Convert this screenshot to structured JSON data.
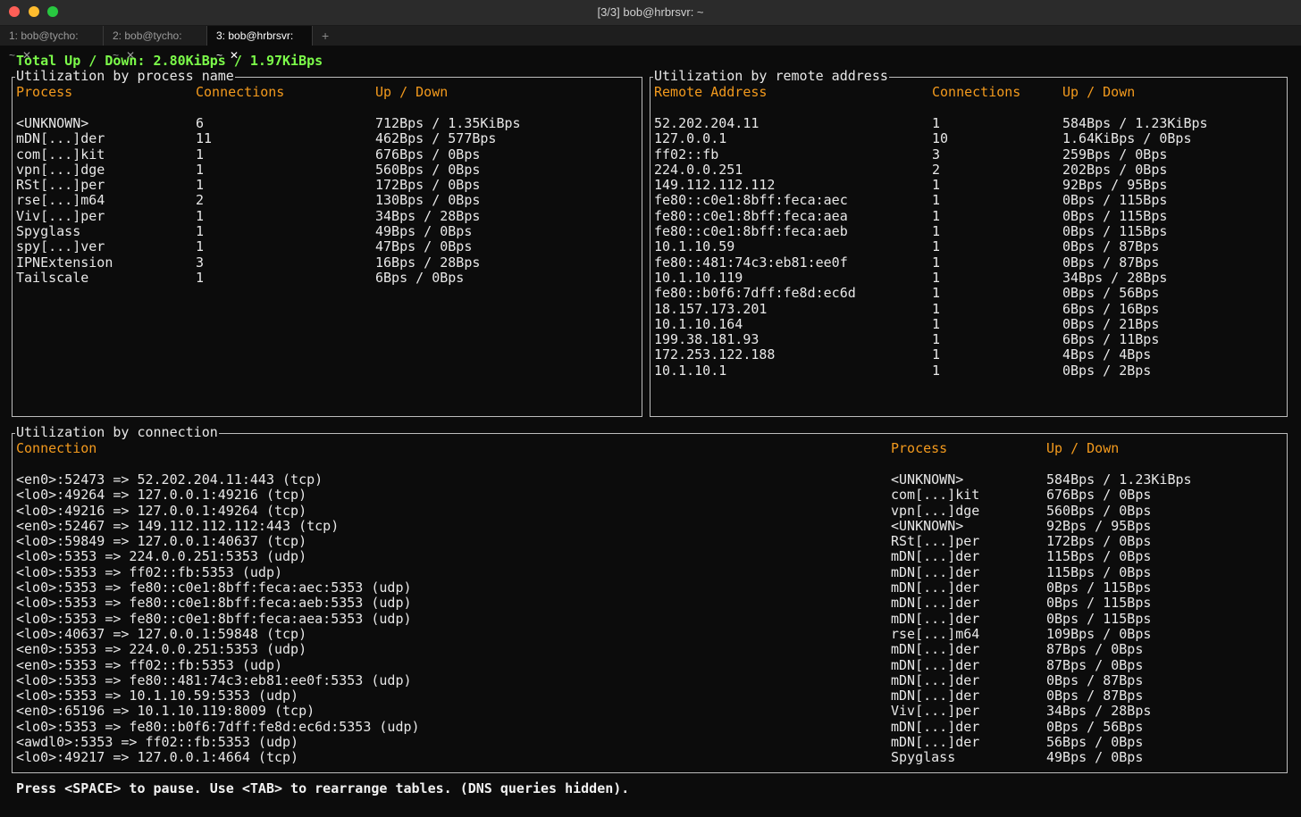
{
  "window": {
    "title": "[3/3] bob@hrbrsvr: ~",
    "tabs": [
      {
        "label": "1: bob@tycho: ~",
        "active": false
      },
      {
        "label": "2: bob@tycho: ~",
        "active": false
      },
      {
        "label": "3: bob@hrbrsvr: ~",
        "active": true
      }
    ],
    "close_glyph": "✕",
    "new_tab_glyph": "+"
  },
  "total": "Total Up / Down: 2.80KiBps / 1.97KiBps",
  "process_table": {
    "title": "Utilization by process name",
    "headers": {
      "process": "Process",
      "connections": "Connections",
      "updown": "Up / Down"
    },
    "process": "<UNKNOWN>\nmDN[...]der\ncom[...]kit\nvpn[...]dge\nRSt[...]per\nrse[...]m64\nViv[...]per\nSpyglass\nspy[...]ver\nIPNExtension\nTailscale",
    "connections": "6\n11\n1\n1\n1\n2\n1\n1\n1\n3\n1",
    "updown": "712Bps / 1.35KiBps\n462Bps / 577Bps\n676Bps / 0Bps\n560Bps / 0Bps\n172Bps / 0Bps\n130Bps / 0Bps\n34Bps / 28Bps\n49Bps / 0Bps\n47Bps / 0Bps\n16Bps / 28Bps\n6Bps / 0Bps"
  },
  "remote_table": {
    "title": "Utilization by remote address",
    "headers": {
      "address": "Remote Address",
      "connections": "Connections",
      "updown": "Up / Down"
    },
    "address": "52.202.204.11\n127.0.0.1\nff02::fb\n224.0.0.251\n149.112.112.112\nfe80::c0e1:8bff:feca:aec\nfe80::c0e1:8bff:feca:aea\nfe80::c0e1:8bff:feca:aeb\n10.1.10.59\nfe80::481:74c3:eb81:ee0f\n10.1.10.119\nfe80::b0f6:7dff:fe8d:ec6d\n18.157.173.201\n10.1.10.164\n199.38.181.93\n172.253.122.188\n10.1.10.1",
    "connections": "1\n10\n3\n2\n1\n1\n1\n1\n1\n1\n1\n1\n1\n1\n1\n1\n1",
    "updown": "584Bps / 1.23KiBps\n1.64KiBps / 0Bps\n259Bps / 0Bps\n202Bps / 0Bps\n92Bps / 95Bps\n0Bps / 115Bps\n0Bps / 115Bps\n0Bps / 115Bps\n0Bps / 87Bps\n0Bps / 87Bps\n34Bps / 28Bps\n0Bps / 56Bps\n6Bps / 16Bps\n0Bps / 21Bps\n6Bps / 11Bps\n4Bps / 4Bps\n0Bps / 2Bps"
  },
  "connection_table": {
    "title": "Utilization by connection",
    "headers": {
      "connection": "Connection",
      "process": "Process",
      "updown": "Up / Down"
    },
    "connection": "<en0>:52473 => 52.202.204.11:443 (tcp)\n<lo0>:49264 => 127.0.0.1:49216 (tcp)\n<lo0>:49216 => 127.0.0.1:49264 (tcp)\n<en0>:52467 => 149.112.112.112:443 (tcp)\n<lo0>:59849 => 127.0.0.1:40637 (tcp)\n<lo0>:5353 => 224.0.0.251:5353 (udp)\n<lo0>:5353 => ff02::fb:5353 (udp)\n<lo0>:5353 => fe80::c0e1:8bff:feca:aec:5353 (udp)\n<lo0>:5353 => fe80::c0e1:8bff:feca:aeb:5353 (udp)\n<lo0>:5353 => fe80::c0e1:8bff:feca:aea:5353 (udp)\n<lo0>:40637 => 127.0.0.1:59848 (tcp)\n<en0>:5353 => 224.0.0.251:5353 (udp)\n<en0>:5353 => ff02::fb:5353 (udp)\n<lo0>:5353 => fe80::481:74c3:eb81:ee0f:5353 (udp)\n<lo0>:5353 => 10.1.10.59:5353 (udp)\n<en0>:65196 => 10.1.10.119:8009 (tcp)\n<lo0>:5353 => fe80::b0f6:7dff:fe8d:ec6d:5353 (udp)\n<awdl0>:5353 => ff02::fb:5353 (udp)\n<lo0>:49217 => 127.0.0.1:4664 (tcp)",
    "process": "<UNKNOWN>\ncom[...]kit\nvpn[...]dge\n<UNKNOWN>\nRSt[...]per\nmDN[...]der\nmDN[...]der\nmDN[...]der\nmDN[...]der\nmDN[...]der\nrse[...]m64\nmDN[...]der\nmDN[...]der\nmDN[...]der\nmDN[...]der\nViv[...]per\nmDN[...]der\nmDN[...]der\nSpyglass",
    "updown": "584Bps / 1.23KiBps\n676Bps / 0Bps\n560Bps / 0Bps\n92Bps / 95Bps\n172Bps / 0Bps\n115Bps / 0Bps\n115Bps / 0Bps\n0Bps / 115Bps\n0Bps / 115Bps\n0Bps / 115Bps\n109Bps / 0Bps\n87Bps / 0Bps\n87Bps / 0Bps\n0Bps / 87Bps\n0Bps / 87Bps\n34Bps / 28Bps\n0Bps / 56Bps\n56Bps / 0Bps\n49Bps / 0Bps"
  },
  "footer": "Press <SPACE> to pause. Use <TAB> to rearrange tables. (DNS queries hidden)."
}
